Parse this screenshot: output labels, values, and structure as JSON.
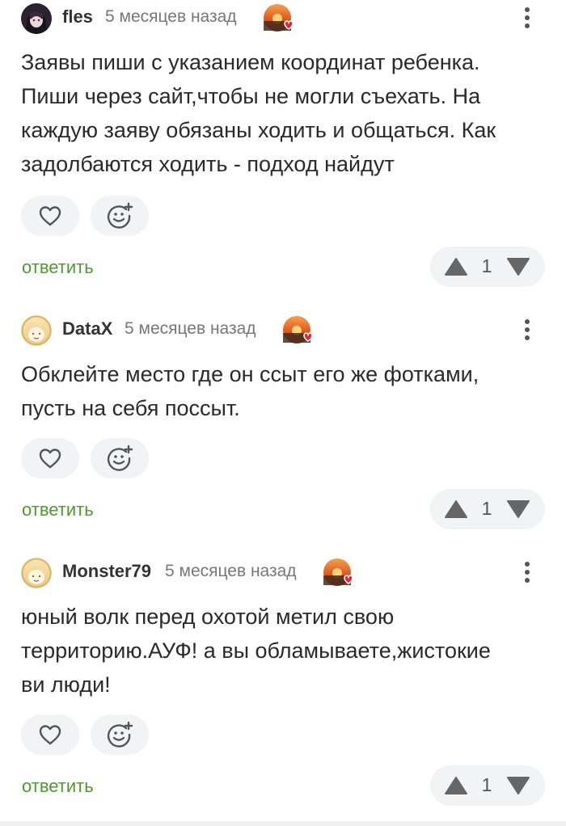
{
  "comments": [
    {
      "author": "fles",
      "time": "5 месяцев назад",
      "lines": [
        "Заявы пиши с указанием координат ребенка.",
        "Пиши через сайт,чтобы не могли съехать. На",
        "каждую заяву обязаны ходить и общаться. Как",
        "задолбаются ходить - подход найдут"
      ],
      "reply_label": "ответить",
      "rating": "1"
    },
    {
      "author": "DataX",
      "time": "5 месяцев назад",
      "lines": [
        "Обклейте место где он ссыт его же фотками,",
        "пусть на себя поссыт."
      ],
      "reply_label": "ответить",
      "rating": "1"
    },
    {
      "author": "Monster79",
      "time": "5 месяцев назад",
      "lines": [
        "юный волк перед охотой метил свою",
        "территорию.АУФ! а вы обламываете,жистокие",
        "ви люди!"
      ],
      "reply_label": "ответить",
      "rating": "1"
    }
  ],
  "colors": {
    "reply_green": "#4e9a2e",
    "pill_bg": "#f2f3f5",
    "icon_gray": "#555555"
  },
  "icons": {
    "like": "heart-icon",
    "reaction": "smiley-plus-icon",
    "upvote": "triangle-up-icon",
    "downvote": "triangle-down-icon",
    "menu": "kebab-menu-icon",
    "award": "sunset-heart-award-icon"
  }
}
